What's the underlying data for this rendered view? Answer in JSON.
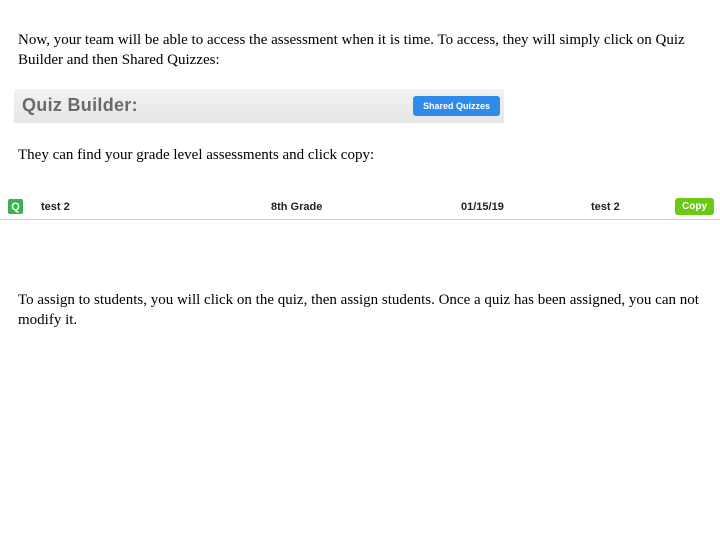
{
  "paragraphs": {
    "p1": "Now, your team will be able to access the assessment when it is time.  To access, they will simply click on Quiz Builder and then Shared Quizzes:",
    "p2": "They can find your grade level assessments and click copy:",
    "p3": "To assign to students, you will click on the quiz, then assign students.  Once a quiz has been assigned, you can not modify it."
  },
  "quiz_builder_bar": {
    "title": "Quiz Builder:",
    "shared_button": "Shared Quizzes"
  },
  "quiz_row": {
    "badge": "Q",
    "name": "test 2",
    "grade": "8th Grade",
    "date": "01/15/19",
    "misc": "test 2",
    "copy_label": "Copy"
  }
}
